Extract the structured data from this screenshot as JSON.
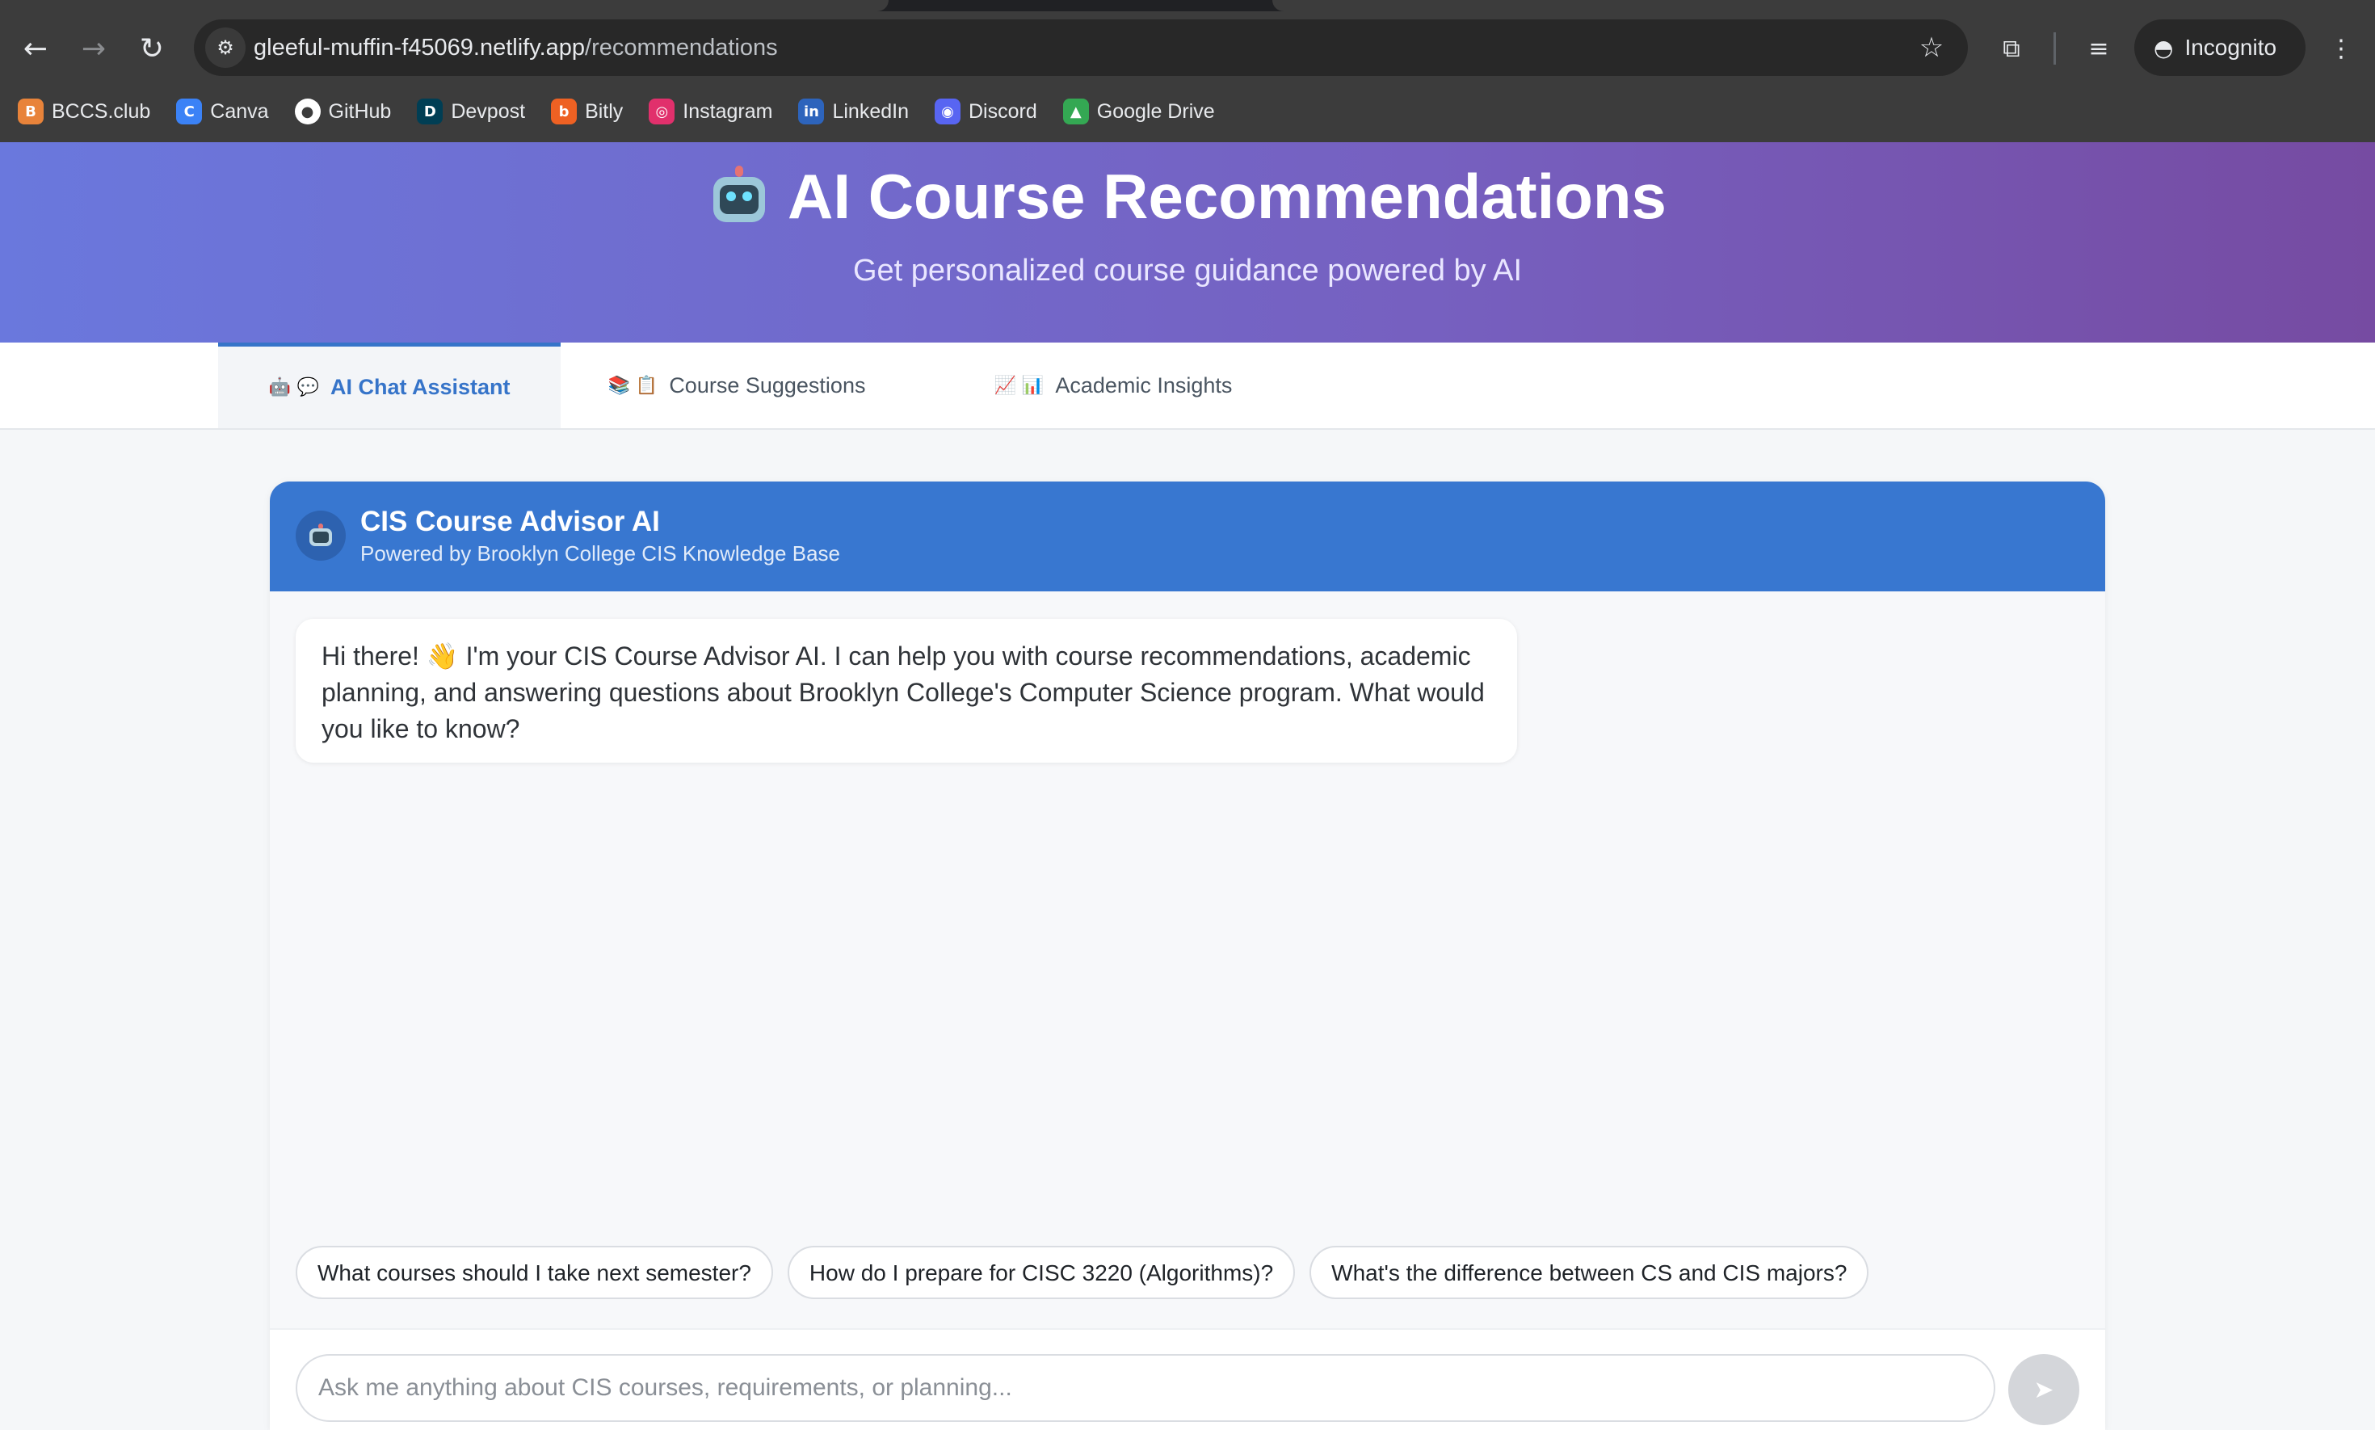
{
  "browser": {
    "url_host": "gleeful-muffin-f45069.netlify.app",
    "url_path": "/recommendations",
    "incognito_label": "Incognito",
    "bookmarks": [
      {
        "label": "BCCS.club",
        "icon": "bccs-icon",
        "color": "#e8833a",
        "glyph": "B"
      },
      {
        "label": "Canva",
        "icon": "canva-icon",
        "color": "#3b82f6",
        "glyph": "C"
      },
      {
        "label": "GitHub",
        "icon": "github-icon",
        "color": "#ffffff",
        "glyph": "●"
      },
      {
        "label": "Devpost",
        "icon": "devpost-icon",
        "color": "#003e54",
        "glyph": "D"
      },
      {
        "label": "Bitly",
        "icon": "bitly-icon",
        "color": "#ee6123",
        "glyph": "b"
      },
      {
        "label": "Instagram",
        "icon": "instagram-icon",
        "color": "#e1306c",
        "glyph": "◎"
      },
      {
        "label": "LinkedIn",
        "icon": "linkedin-icon",
        "color": "#2d64bc",
        "glyph": "in"
      },
      {
        "label": "Discord",
        "icon": "discord-icon",
        "color": "#5865f2",
        "glyph": "◉"
      },
      {
        "label": "Google Drive",
        "icon": "google-drive-icon",
        "color": "#34a853",
        "glyph": "▲"
      }
    ]
  },
  "hero": {
    "title": "AI Course Recommendations",
    "subtitle": "Get personalized course guidance powered by AI"
  },
  "tabs": [
    {
      "label": "AI Chat Assistant",
      "icons": "🤖 💬",
      "active": true
    },
    {
      "label": "Course Suggestions",
      "icons": "📚 📋",
      "active": false
    },
    {
      "label": "Academic Insights",
      "icons": "📈 📊",
      "active": false
    }
  ],
  "chat": {
    "name": "CIS Course Advisor AI",
    "subtitle": "Powered by Brooklyn College CIS Knowledge Base",
    "greeting": "Hi there! 👋 I'm your CIS Course Advisor AI. I can help you with course recommendations, academic planning, and answering questions about Brooklyn College's Computer Science program. What would you like to know?",
    "suggestions": [
      "What courses should I take next semester?",
      "How do I prepare for CISC 3220 (Algorithms)?",
      "What's the difference between CS and CIS majors?"
    ],
    "input_placeholder": "Ask me anything about CIS courses, requirements, or planning...",
    "input_value": "",
    "send_glyph": "➤"
  },
  "colors": {
    "accent": "#3877d0",
    "hero_start": "#6a78dd",
    "hero_end": "#764ba2"
  }
}
